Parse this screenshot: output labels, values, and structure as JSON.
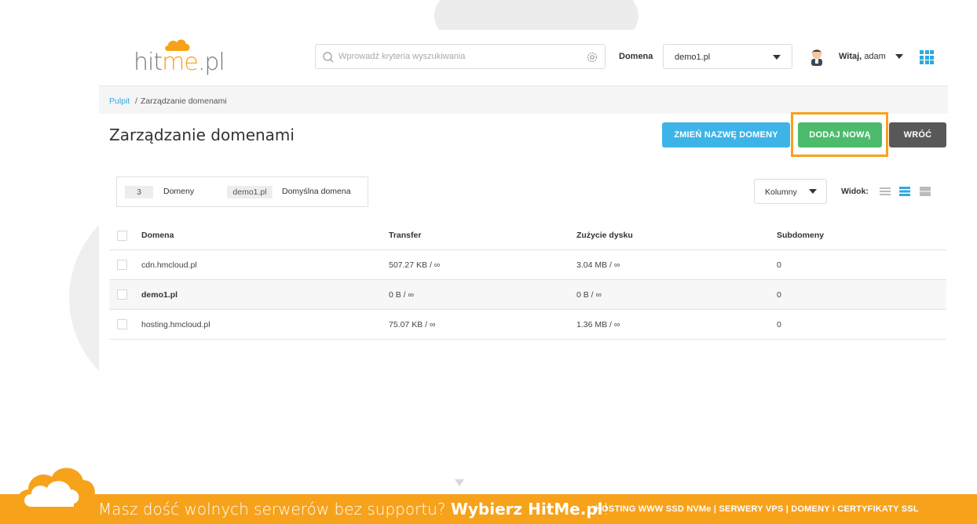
{
  "header": {
    "logo": {
      "part1": "hit",
      "part2": "me",
      "part3": ".pl"
    },
    "search_placeholder": "Wprowadź kryteria wyszukiwania",
    "domain_label": "Domena",
    "domain_value": "demo1.pl",
    "greeting_bold": "Witaj,",
    "greeting_user": "adam"
  },
  "breadcrumb": {
    "link": "Pulpit",
    "separator": "/",
    "current": "Zarządzanie domenami"
  },
  "page": {
    "title": "Zarządzanie domenami",
    "buttons": {
      "rename": "ZMIEŃ NAZWĘ DOMENY",
      "add": "DODAJ NOWĄ",
      "back": "WRÓĆ"
    }
  },
  "stats": {
    "count": "3",
    "count_label": "Domeny",
    "default_domain": "demo1.pl",
    "default_label": "Domyślna domena"
  },
  "toolbar": {
    "columns_label": "Kolumny",
    "view_label": "Widok:"
  },
  "table": {
    "headers": [
      "Domena",
      "Transfer",
      "Zużycie dysku",
      "Subdomeny"
    ],
    "rows": [
      {
        "domain": "cdn.hmcloud.pl",
        "transfer": "507.27 KB / ∞",
        "disk": "3.04 MB / ∞",
        "subdomains": "0"
      },
      {
        "domain": "demo1.pl",
        "transfer": "0 B / ∞",
        "disk": "0 B / ∞",
        "subdomains": "0"
      },
      {
        "domain": "hosting.hmcloud.pl",
        "transfer": "75.07 KB / ∞",
        "disk": "1.36 MB / ∞",
        "subdomains": "0"
      }
    ]
  },
  "footer": {
    "message": "Masz dość wolnych serwerów bez supportu?",
    "cta": "Wybierz HitMe.pl",
    "cta_end": "!",
    "services": "HOSTING WWW SSD NVMe | SERWERY VPS | DOMENY i CERTYFIKATY SSL"
  },
  "colors": {
    "accent_blue": "#3db4e8",
    "accent_green": "#4cbb6c",
    "accent_gray": "#585858",
    "brand_orange": "#f7a21b"
  },
  "icons": [
    "search-icon",
    "gear-icon",
    "chevron-down-icon",
    "avatar",
    "apps-grid-icon",
    "list-view-icon",
    "compact-view-icon",
    "grid-view-icon",
    "cloud-icon"
  ]
}
